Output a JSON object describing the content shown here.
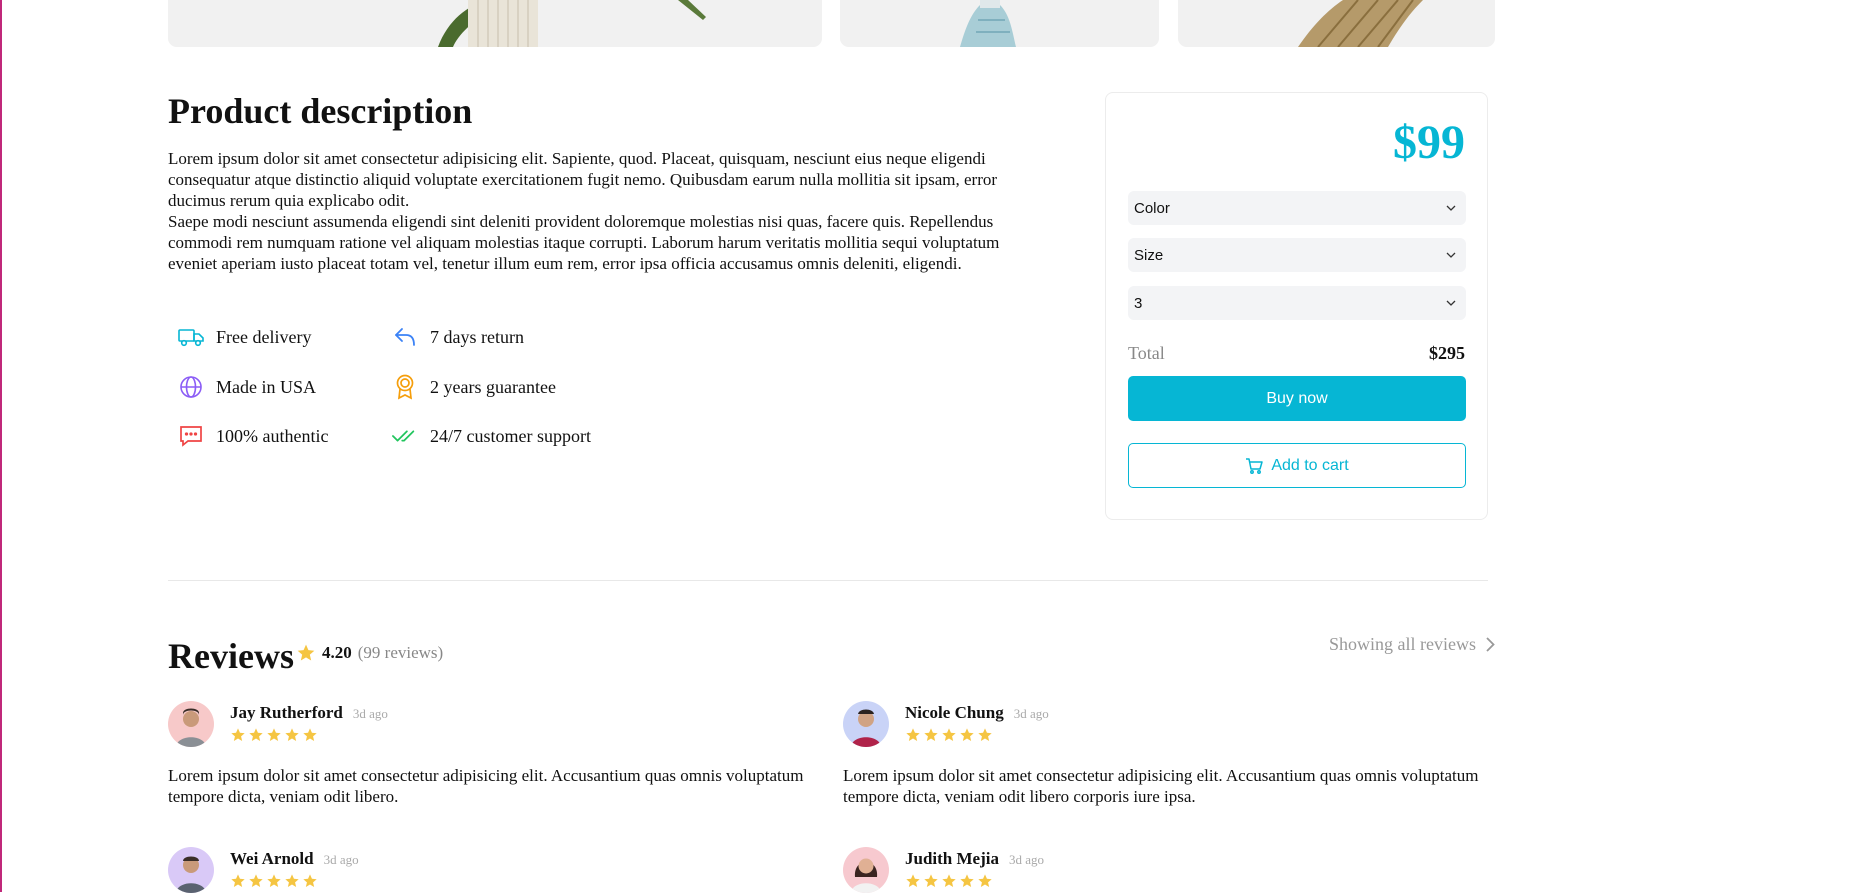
{
  "colors": {
    "accent": "#06b6d4",
    "star": "#f5c542",
    "muted": "#888888"
  },
  "description": {
    "title": "Product description",
    "paragraph1": "Lorem ipsum dolor sit amet consectetur adipisicing elit. Sapiente, quod. Placeat, quisquam, nesciunt eius neque eligendi consequatur atque distinctio aliquid voluptate exercitationem fugit nemo. Quibusdam earum nulla mollitia sit ipsam, error ducimus rerum quia explicabo odit.",
    "paragraph2": "Saepe modi nesciunt assumenda eligendi sint deleniti provident doloremque molestias nisi quas, facere quis. Repellendus commodi rem numquam ratione vel aliquam molestias itaque corrupti. Laborum harum veritatis mollitia sequi voluptatum eveniet aperiam iusto placeat totam vel, tenetur illum eum rem, error ipsa officia accusamus omnis deleniti, eligendi."
  },
  "features": [
    {
      "label": "Free delivery",
      "icon": "truck-icon"
    },
    {
      "label": "7 days return",
      "icon": "return-arrow-icon"
    },
    {
      "label": "Made in USA",
      "icon": "globe-icon"
    },
    {
      "label": "2 years guarantee",
      "icon": "medal-icon"
    },
    {
      "label": "100% authentic",
      "icon": "chat-bubble-icon"
    },
    {
      "label": "24/7 customer support",
      "icon": "double-check-icon"
    }
  ],
  "purchase": {
    "price": "$99",
    "color_select": "Color",
    "size_select": "Size",
    "quantity_select": "3",
    "total_label": "Total",
    "total_value": "$295",
    "buy_label": "Buy now",
    "cart_label": "Add to cart"
  },
  "reviews": {
    "title": "Reviews",
    "average": "4.20",
    "count": "(99 reviews)",
    "show_all": "Showing all reviews",
    "items": [
      {
        "name": "Jay Rutherford",
        "ago": "3d ago",
        "rating": 5,
        "text": "Lorem ipsum dolor sit amet consectetur adipisicing elit. Accusantium quas omnis voluptatum tempore dicta, veniam odit libero."
      },
      {
        "name": "Nicole Chung",
        "ago": "3d ago",
        "rating": 5,
        "text": "Lorem ipsum dolor sit amet consectetur adipisicing elit. Accusantium quas omnis voluptatum tempore dicta, veniam odit libero corporis iure ipsa."
      },
      {
        "name": "Wei Arnold",
        "ago": "3d ago",
        "rating": 5,
        "text": ""
      },
      {
        "name": "Judith Mejia",
        "ago": "3d ago",
        "rating": 5,
        "text": ""
      }
    ]
  }
}
